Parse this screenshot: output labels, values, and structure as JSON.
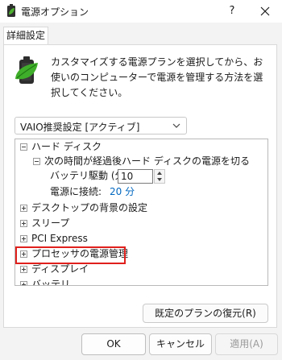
{
  "window": {
    "title": "電源オプション",
    "help_label": "?",
    "app_icon": "battery-leaf-icon",
    "close_icon": "close-icon"
  },
  "tabs": [
    {
      "label": "詳細設定"
    }
  ],
  "intro": {
    "icon": "battery-leaf-icon",
    "text": "カスタマイズする電源プランを選択してから、お使いのコンピューターで電源を管理する方法を選択してください。"
  },
  "plan_select": {
    "value": "VAIO推奨設定 [アクティブ]",
    "icon": "chevron-down-icon"
  },
  "tree": {
    "hard_disk": {
      "label": "ハード ディスク",
      "child": {
        "label": "次の時間が経過後ハード ディスクの電源を切る",
        "battery_label": "バッテリ駆動 (分):",
        "battery_value": "10",
        "plugged_label": "電源に接続:",
        "plugged_value": "20 分"
      }
    },
    "items": [
      {
        "label": "デスクトップの背景の設定"
      },
      {
        "label": "スリープ"
      },
      {
        "label": "PCI Express"
      },
      {
        "label": "プロセッサの電源管理"
      },
      {
        "label": "ディスプレイ"
      },
      {
        "label": "バッテリ"
      }
    ]
  },
  "highlight_color": "#e0201c",
  "link_color": "#0067c0",
  "buttons": {
    "restore": "既定のプランの復元(R)",
    "ok": "OK",
    "cancel": "キャンセル",
    "apply": "適用(A)"
  }
}
